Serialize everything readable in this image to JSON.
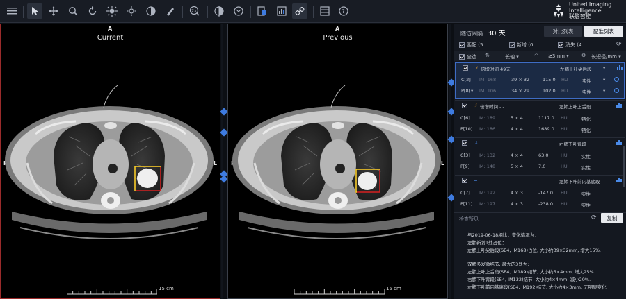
{
  "toolbar": {
    "icons": [
      "menu-icon",
      "pointer-icon",
      "pan-icon",
      "zoom-icon",
      "rotate-icon",
      "window-level-icon",
      "brightness-icon",
      "invert-icon",
      "measure-icon",
      "magnify-2x-icon",
      "reset-icon",
      "cine-icon",
      "export-icon",
      "report-icon",
      "link-icon",
      "layout-icon",
      "help-icon"
    ],
    "magnify_label": "2x"
  },
  "logo": {
    "line1": "United Imaging",
    "line2": "Intelligence",
    "line3": "联影智能"
  },
  "viewports": {
    "current": {
      "label": "Current",
      "orient_top": "A",
      "orient_left": "R",
      "orient_right": "L",
      "scale_label": "15 cm"
    },
    "previous": {
      "label": "Previous",
      "orient_top": "A",
      "orient_left": "R",
      "orient_right": "L",
      "scale_label": "15 cm"
    }
  },
  "panel": {
    "interval_label": "随访间隔:",
    "interval_value": "30 天",
    "tab_compare": "对比列表",
    "tab_match": "配准列表",
    "filter_match": "匹配 (5...",
    "filter_new": "新增 (0...",
    "filter_lost": "消失 (4...",
    "select_all": "全选",
    "sort_label": "长轴",
    "size_filter": "≥3mm",
    "diameter_label": "长短径/mm",
    "groups": [
      {
        "doubling": "倍增时间 49天",
        "location": "左肺上叶尖后段",
        "rows": [
          {
            "id": "C[2]",
            "im": "IM: 168",
            "size": "39 × 32",
            "hu": "115.0",
            "unit": "HU",
            "type": "实性"
          },
          {
            "id": "P[8]",
            "im": "IM: 106",
            "size": "34 × 29",
            "hu": "102.0",
            "unit": "HU",
            "type": "实性"
          }
        ]
      },
      {
        "doubling": "倍增时间 - -",
        "location": "左肺上叶上舌段",
        "rows": [
          {
            "id": "C[6]",
            "im": "IM: 189",
            "size": "5 × 4",
            "hu": "1117.0",
            "unit": "HU",
            "type": "钙化"
          },
          {
            "id": "P[10]",
            "im": "IM: 186",
            "size": "4 × 4",
            "hu": "1689.0",
            "unit": "HU",
            "type": "钙化"
          }
        ]
      },
      {
        "doubling": "",
        "location": "右肺下叶背段",
        "rows": [
          {
            "id": "C[3]",
            "im": "IM: 132",
            "size": "4 × 4",
            "hu": "63.0",
            "unit": "HU",
            "type": "实性"
          },
          {
            "id": "P[9]",
            "im": "IM: 148",
            "size": "5 × 4",
            "hu": "7.0",
            "unit": "HU",
            "type": "实性"
          }
        ]
      },
      {
        "doubling": "",
        "location": "左肺下叶前内基底段",
        "rows": [
          {
            "id": "C[7]",
            "im": "IM: 192",
            "size": "4 × 3",
            "hu": "-147.0",
            "unit": "HU",
            "type": "实性"
          },
          {
            "id": "P[11]",
            "im": "IM: 197",
            "size": "4 × 3",
            "hu": "-238.0",
            "unit": "HU",
            "type": "实性"
          }
        ]
      }
    ],
    "findings_label": "检查所见",
    "copy_button": "复制",
    "report_lines": [
      "与2019-06-18相比，变化情况为：",
      "左肺新发1处占位：",
      "左肺上叶尖后段(SE4, IM168)占位, 大小约39×32mm, 增大15%.",
      "",
      "双肺多发微结节, 最大的3处为:",
      "左肺上叶上舌段(SE4, IM189)结节, 大小约5×4mm, 增大25%.",
      "右肺下叶背段(SE4, IM132)结节, 大小约4×4mm, 减小20%.",
      "左肺下叶前内基底段(SE4, IM192)结节, 大小约4×3mm, 无明显变化."
    ]
  },
  "colors": {
    "accent": "#3e7be0",
    "current_border": "#9a2b2b",
    "box_red": "#d62020",
    "box_yellow": "#e8d62a"
  }
}
